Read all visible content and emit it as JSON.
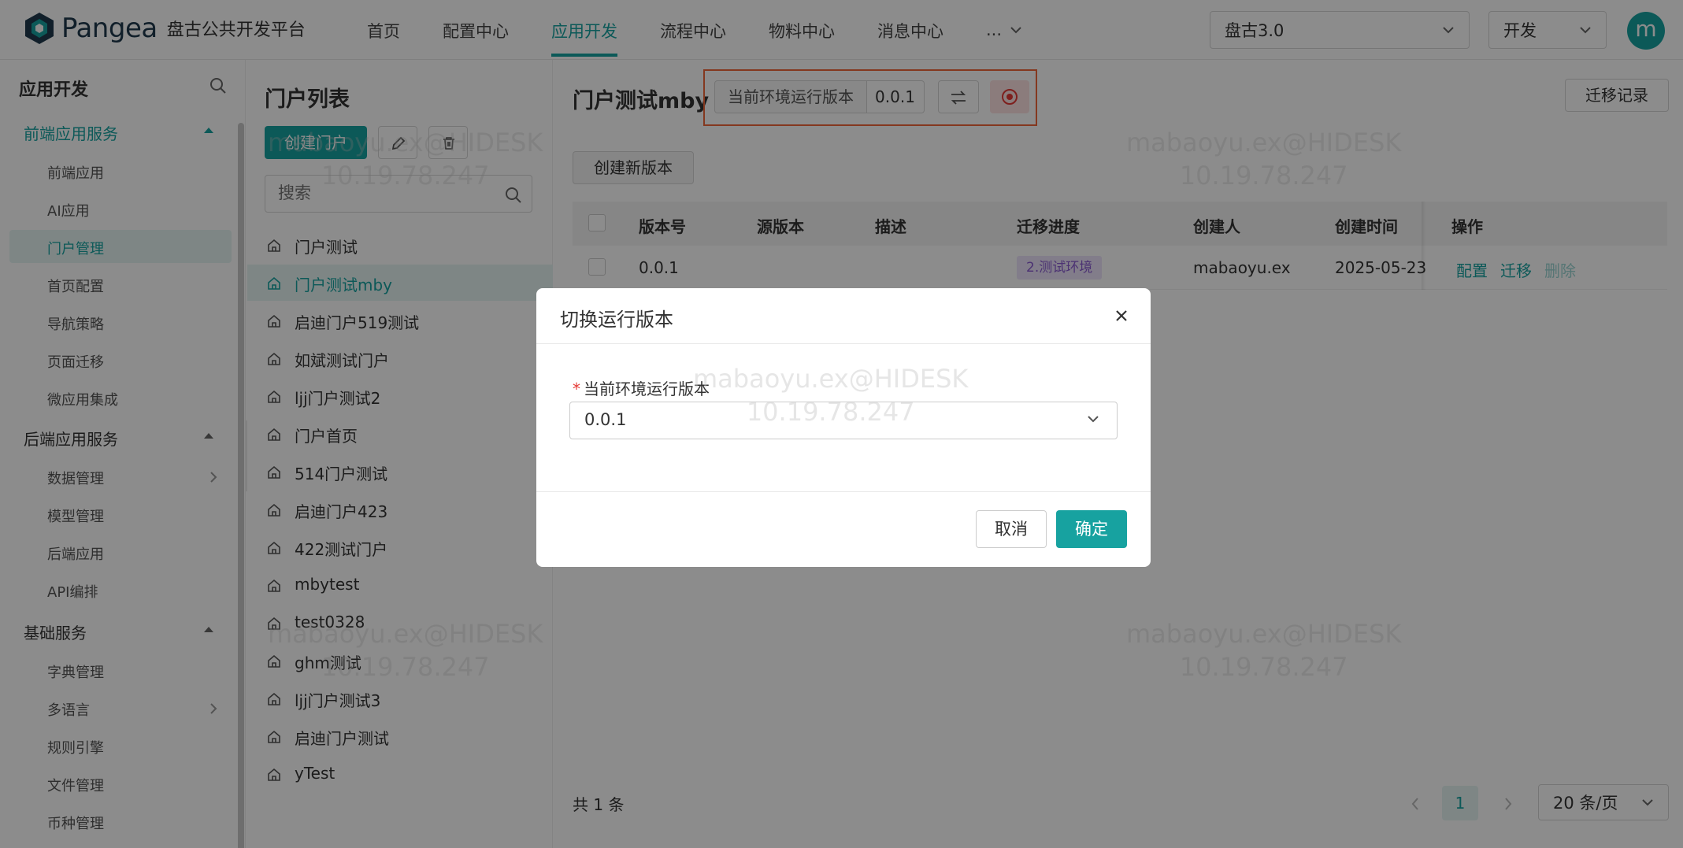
{
  "brand": {
    "name": "Pangea",
    "subtitle": "盘古公共开发平台"
  },
  "nav": {
    "items": [
      "首页",
      "配置中心",
      "应用开发",
      "流程中心",
      "物料中心",
      "消息中心"
    ],
    "more": "...",
    "active_index": 2
  },
  "header": {
    "workspace": "盘古3.0",
    "env": "开发",
    "avatar": "m"
  },
  "colors": {
    "accent": "#17a2a0",
    "highlight_border": "#f0673a",
    "tag_purple": "#8a5cd1"
  },
  "sidebar": {
    "title": "应用开发",
    "groups": [
      {
        "label": "前端应用服务",
        "items": [
          "前端应用",
          "AI应用",
          "门户管理",
          "首页配置",
          "导航策略",
          "页面迁移",
          "微应用集成"
        ]
      },
      {
        "label": "后端应用服务",
        "items": [
          "数据管理",
          "模型管理",
          "后端应用",
          "API编排"
        ]
      },
      {
        "label": "基础服务",
        "items": [
          "字典管理",
          "多语言",
          "规则引擎",
          "文件管理",
          "币种管理"
        ]
      }
    ],
    "active_item": "门户管理"
  },
  "portal_list": {
    "title": "门户列表",
    "create_label": "创建门户",
    "search_placeholder": "搜索",
    "items": [
      "门户测试",
      "门户测试mby",
      "启迪门户519测试",
      "如斌测试门户",
      "ljj门户测试2",
      "门户首页",
      "514门户测试",
      "启迪门户423",
      "422测试门户",
      "mbytest",
      "test0328",
      "ghm测试",
      "ljj门户测试3",
      "启迪门户测试",
      "yTest"
    ],
    "active_index": 1
  },
  "main": {
    "title": "门户测试mby",
    "version_label": "当前环境运行版本",
    "version_value": "0.0.1",
    "migration_record": "迁移记录",
    "create_version": "创建新版本",
    "table": {
      "columns": [
        "版本号",
        "源版本",
        "描述",
        "迁移进度",
        "创建人",
        "创建时间",
        "操作"
      ],
      "rows": [
        {
          "version": "0.0.1",
          "source": "",
          "desc": "",
          "progress": "2.测试环境",
          "creator": "mabaoyu.ex",
          "created": "2025-05-23",
          "actions": [
            "配置",
            "迁移",
            "删除"
          ]
        }
      ]
    },
    "total": "共 1 条",
    "page": "1",
    "page_size": "20 条/页"
  },
  "modal": {
    "title": "切换运行版本",
    "field_label": "当前环境运行版本",
    "field_value": "0.0.1",
    "cancel": "取消",
    "ok": "确定"
  },
  "watermark": {
    "line1": "mabaoyu.ex@HIDESK",
    "line2": "10.19.78.247"
  }
}
